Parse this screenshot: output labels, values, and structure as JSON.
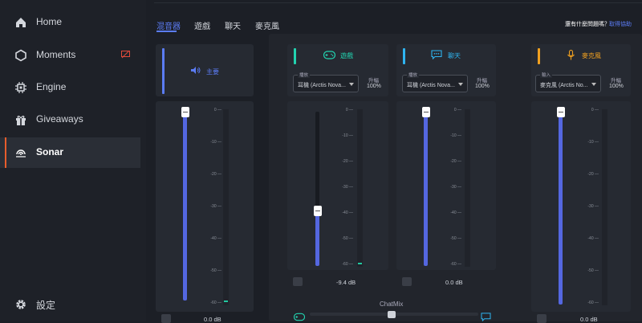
{
  "sidebar": {
    "items": [
      {
        "label": "Home",
        "icon": "home-icon"
      },
      {
        "label": "Moments",
        "icon": "moments-icon"
      },
      {
        "label": "Engine",
        "icon": "engine-icon"
      },
      {
        "label": "Giveaways",
        "icon": "giveaways-icon"
      },
      {
        "label": "Sonar",
        "icon": "sonar-icon",
        "active": true
      }
    ],
    "settings_label": "設定"
  },
  "tabs": [
    "混音器",
    "遊戲",
    "聊天",
    "麥克風"
  ],
  "help": {
    "question": "還有什麼問題嗎？",
    "link": "取得協助"
  },
  "colors": {
    "master": "#5b7cf5",
    "game": "#22d3b0",
    "chat": "#2fb4f0",
    "mic": "#f0a020",
    "fader": "#5467e0",
    "sidebar_active": "#e85d2c"
  },
  "channels": {
    "master": {
      "name": "主要",
      "db": "0.0 dB",
      "level": 1.0
    },
    "game": {
      "name": "遊戲",
      "select_label": "播放",
      "select_value": "耳機 (Arctis Nova...",
      "boost_label": "升幅",
      "boost_value": "100%",
      "db": "-9.4 dB",
      "level": 0.6
    },
    "chat": {
      "name": "聊天",
      "select_label": "播放",
      "select_value": "耳機 (Arctis Nova...",
      "boost_label": "升幅",
      "boost_value": "100%",
      "db": "0.0 dB",
      "level": 1.0
    },
    "mic": {
      "name": "麥克風",
      "select_label": "輸入",
      "select_value": "麥克風 (Arctis No...",
      "boost_label": "升幅",
      "boost_value": "100%",
      "db": "0.0 dB",
      "level": 1.0
    }
  },
  "scale": [
    "0",
    "-10",
    "-20",
    "-30",
    "-40",
    "-50",
    "-60"
  ],
  "chatmix": {
    "label": "ChatMix",
    "value": 0.5
  }
}
